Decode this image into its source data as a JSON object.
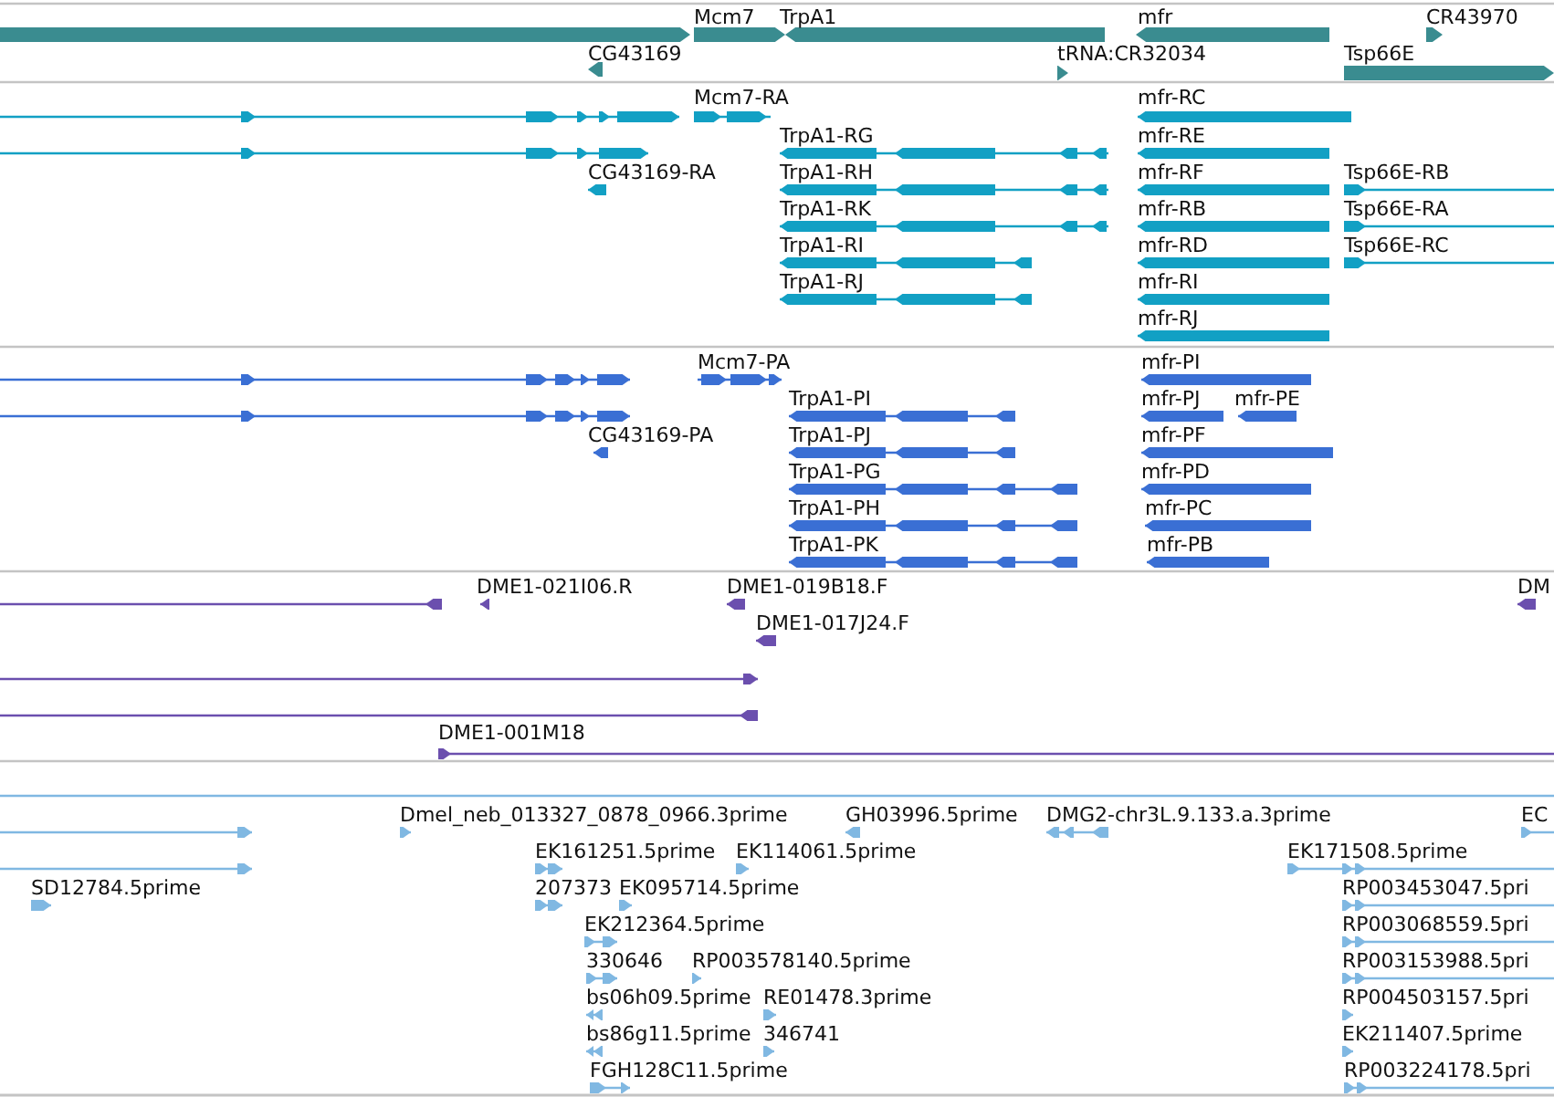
{
  "tracks": [
    {
      "kind": "gene",
      "color": "#3a8c90",
      "features": [
        {
          "reverse": false
        },
        {
          "label": "Mcm7",
          "reverse": false
        },
        {
          "label": "TrpA1",
          "reverse": true
        },
        {
          "label": "mfr",
          "reverse": true
        },
        {
          "label": "CR43970",
          "reverse": false
        },
        {
          "label": "CG43169",
          "reverse": true
        },
        {
          "label": "tRNA:CR32034",
          "reverse": false
        },
        {
          "label": "Tsp66E",
          "reverse": false
        }
      ]
    },
    {
      "kind": "transcript",
      "color": "#12a0c4",
      "features": [
        {
          "reverse": false
        },
        {
          "label": "Mcm7-RA",
          "reverse": false
        },
        {
          "label": "mfr-RC",
          "reverse": true
        },
        {
          "reverse": false
        },
        {
          "label": "TrpA1-RG",
          "reverse": true
        },
        {
          "label": "mfr-RE",
          "reverse": true
        },
        {
          "label": "CG43169-RA",
          "reverse": true
        },
        {
          "label": "TrpA1-RH",
          "reverse": true
        },
        {
          "label": "mfr-RF",
          "reverse": true
        },
        {
          "label": "Tsp66E-RB",
          "reverse": false
        },
        {
          "label": "TrpA1-RK",
          "reverse": true
        },
        {
          "label": "mfr-RB",
          "reverse": true
        },
        {
          "label": "Tsp66E-RA",
          "reverse": false
        },
        {
          "label": "TrpA1-RI",
          "reverse": true
        },
        {
          "label": "mfr-RD",
          "reverse": true
        },
        {
          "label": "Tsp66E-RC",
          "reverse": false
        },
        {
          "label": "TrpA1-RJ",
          "reverse": true
        },
        {
          "label": "mfr-RI",
          "reverse": true
        },
        {
          "label": "mfr-RJ",
          "reverse": true
        }
      ]
    },
    {
      "kind": "transcript",
      "color": "#3a6fd4",
      "features": [
        {
          "reverse": false
        },
        {
          "label": "Mcm7-PA",
          "reverse": false
        },
        {
          "label": "mfr-PI",
          "reverse": true
        },
        {
          "reverse": false
        },
        {
          "label": "TrpA1-PI",
          "reverse": true
        },
        {
          "label": "mfr-PJ",
          "reverse": true
        },
        {
          "label": "mfr-PE",
          "reverse": true
        },
        {
          "label": "CG43169-PA",
          "reverse": true
        },
        {
          "label": "TrpA1-PJ",
          "reverse": true
        },
        {
          "label": "mfr-PF",
          "reverse": true
        },
        {
          "label": "TrpA1-PG",
          "reverse": true
        },
        {
          "label": "mfr-PD",
          "reverse": true
        },
        {
          "label": "TrpA1-PH",
          "reverse": true
        },
        {
          "label": "mfr-PC",
          "reverse": true
        },
        {
          "label": "TrpA1-PK",
          "reverse": true
        },
        {
          "label": "mfr-PB",
          "reverse": true
        }
      ]
    },
    {
      "kind": "transcript",
      "color": "#6b4fae",
      "features": [
        {
          "reverse": true
        },
        {
          "label": "DME1-021I06.R",
          "reverse": true
        },
        {
          "label": "DME1-019B18.F",
          "reverse": true
        },
        {
          "label": "DM",
          "reverse": true
        },
        {
          "label": "DME1-017J24.F",
          "reverse": true
        },
        {
          "reverse": false
        },
        {
          "reverse": true
        },
        {
          "label": "DME1-001M18",
          "reverse": false
        }
      ]
    },
    {
      "kind": "transcript",
      "color": "#80b8e2",
      "features": [
        {
          "reverse": false
        },
        {
          "label": "Dmel_neb_013327_0878_0966.3prime",
          "reverse": false
        },
        {
          "label": "GH03996.5prime",
          "reverse": true
        },
        {
          "label": "DMG2-chr3L.9.133.a.3prime",
          "reverse": true
        },
        {
          "label": "EC",
          "reverse": false
        },
        {
          "reverse": false
        },
        {
          "label": "EK161251.5prime",
          "reverse": false
        },
        {
          "label": "EK114061.5prime",
          "reverse": false
        },
        {
          "label": "EK171508.5prime",
          "reverse": false
        },
        {
          "label": "SD12784.5prime",
          "reverse": false
        },
        {
          "label": "207373",
          "reverse": false
        },
        {
          "label": "EK095714.5prime",
          "reverse": false
        },
        {
          "label": "RP003453047.5pri",
          "reverse": false
        },
        {
          "label": "EK212364.5prime",
          "reverse": false
        },
        {
          "label": "RP003068559.5pri",
          "reverse": false
        },
        {
          "label": "330646",
          "reverse": false
        },
        {
          "label": "RP003578140.5prime",
          "reverse": false
        },
        {
          "label": "RP003153988.5pri",
          "reverse": false
        },
        {
          "label": "bs06h09.5prime",
          "reverse": true
        },
        {
          "label": "RE01478.3prime",
          "reverse": false
        },
        {
          "label": "RP004503157.5pri",
          "reverse": false
        },
        {
          "label": "bs86g11.5prime",
          "reverse": true
        },
        {
          "label": "346741",
          "reverse": false
        },
        {
          "label": "EK211407.5prime",
          "reverse": false
        },
        {
          "label": "FGH128C11.5prime",
          "reverse": false
        },
        {
          "label": "RP003224178.5pri",
          "reverse": false
        }
      ]
    }
  ]
}
